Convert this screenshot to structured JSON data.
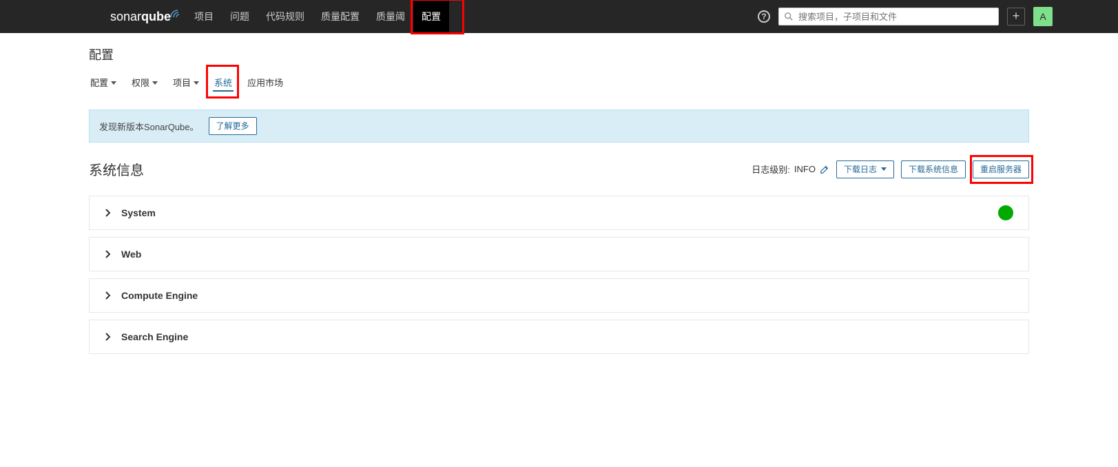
{
  "header": {
    "logo_light": "sonar",
    "logo_bold": "qube",
    "nav": [
      "项目",
      "问题",
      "代码规则",
      "质量配置",
      "质量阈",
      "配置"
    ],
    "nav_active_index": 5,
    "search_placeholder": "搜索项目，子项目和文件",
    "avatar_initial": "A"
  },
  "page": {
    "title": "配置",
    "subnav": [
      {
        "label": "配置",
        "caret": true
      },
      {
        "label": "权限",
        "caret": true
      },
      {
        "label": "项目",
        "caret": true
      },
      {
        "label": "系统",
        "caret": false
      },
      {
        "label": "应用市场",
        "caret": false
      }
    ],
    "subnav_active_index": 3
  },
  "notice": {
    "text": "发现新版本SonarQube。",
    "button": "了解更多"
  },
  "section": {
    "title": "系统信息",
    "loglevel_label": "日志级别:",
    "loglevel_value": "INFO",
    "buttons": {
      "download_logs": "下载日志",
      "download_sysinfo": "下载系统信息",
      "restart": "重启服务器"
    }
  },
  "panels": [
    {
      "title": "System",
      "status": true
    },
    {
      "title": "Web",
      "status": false
    },
    {
      "title": "Compute Engine",
      "status": false
    },
    {
      "title": "Search Engine",
      "status": false
    }
  ]
}
